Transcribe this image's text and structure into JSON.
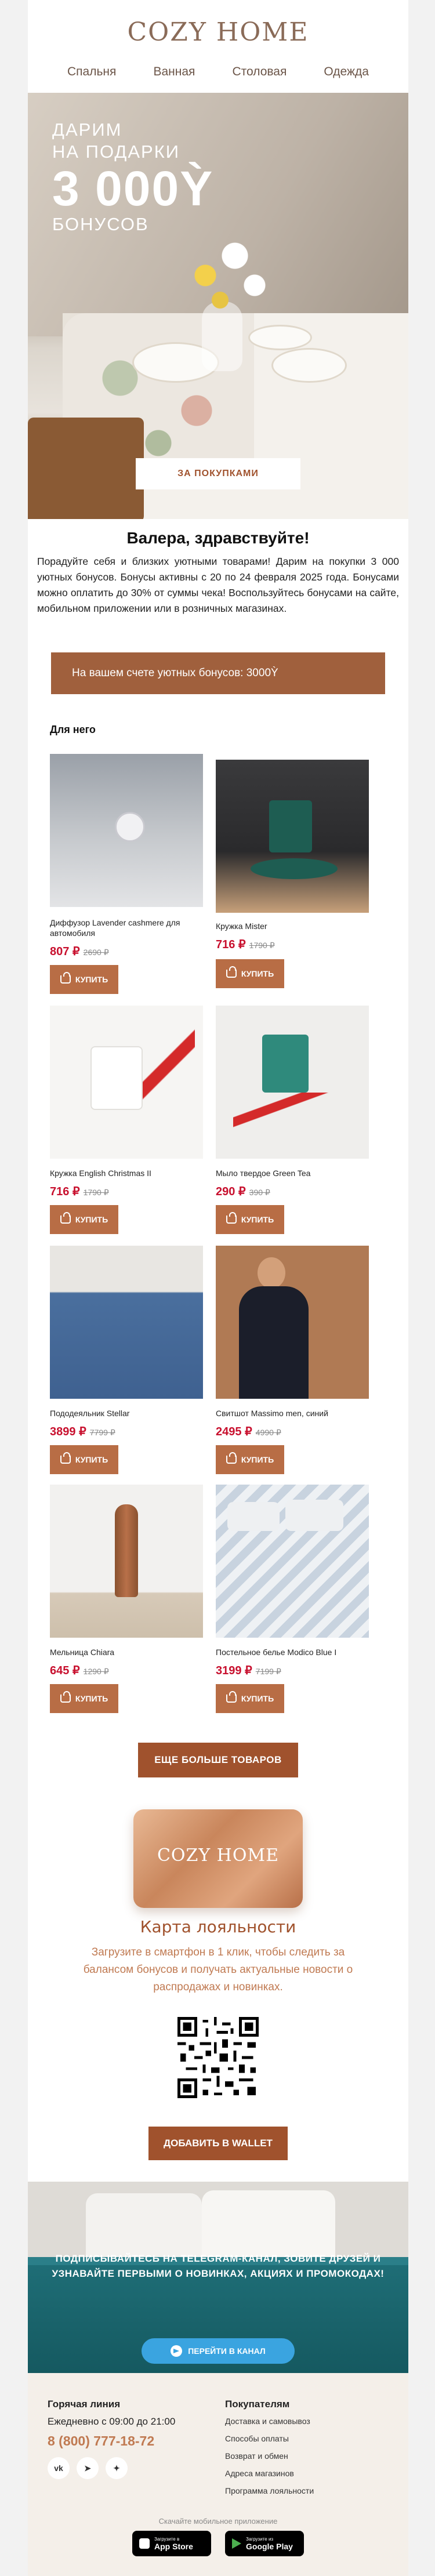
{
  "header": {
    "logo": "COZY HOME",
    "nav": [
      "Спальня",
      "Ванная",
      "Столовая",
      "Одежда"
    ]
  },
  "hero": {
    "line1": "ДАРИМ",
    "line2": "НА ПОДАРКИ",
    "amount": "3 000Ỳ",
    "line3": "БОНУСОВ",
    "cta": "ЗА ПОКУПКАМИ"
  },
  "greeting": {
    "title": "Валера, здравствуйте!",
    "text": "Порадуйте себя и близких уютными товарами! Дарим на покупки 3 000 уютных бонусов. Бонусы активны с 20 по 24 февраля 2025 года. Бонусами можно оплатить до 30% от суммы чека! Воспользуйтесь бонусами на сайте, мобильном приложении или в розничных магазинах.",
    "balance": "На вашем счете уютных бонусов: 3000Ỳ"
  },
  "section_title": "Для него",
  "buy_label": "КУПИТЬ",
  "products": [
    {
      "name": "Диффузор Lavender cashmere для автомобиля",
      "price": "807 ₽",
      "old": "2690 ₽"
    },
    {
      "name": "Кружка Mister",
      "price": "716 ₽",
      "old": "1790 ₽"
    },
    {
      "name": "Кружка English Christmas II",
      "price": "716 ₽",
      "old": "1790 ₽"
    },
    {
      "name": "Мыло твердое Green Tea",
      "price": "290 ₽",
      "old": "390 ₽"
    },
    {
      "name": "Пододеяльник Stellar",
      "price": "3899 ₽",
      "old": "7799 ₽"
    },
    {
      "name": "Свитшот Massimo men, синий",
      "price": "2495 ₽",
      "old": "4990 ₽"
    },
    {
      "name": "Мельница Chiara",
      "price": "645 ₽",
      "old": "1290 ₽"
    },
    {
      "name": "Постельное белье Modico Blue I",
      "price": "3199 ₽",
      "old": "7199 ₽"
    }
  ],
  "more_button": "ЕЩЕ БОЛЬШЕ ТОВАРОВ",
  "loyalty": {
    "card_logo": "COZY HOME",
    "title": "Карта лояльности",
    "text": "Загрузите в смартфон в 1 клик, чтобы следить за балансом бонусов и получать актуальные новости о распродажах и новинках.",
    "wallet_button": "ДОБАВИТЬ В WALLET"
  },
  "telegram": {
    "text": "ПОДПИСЫВАЙТЕСЬ НА TELEGRAM-КАНАЛ, ЗОВИТЕ ДРУЗЕЙ И УЗНАВАЙТЕ ПЕРВЫМИ О НОВИНКАХ, АКЦИЯХ И ПРОМОКОДАХ!",
    "button": "ПЕРЕЙТИ В КАНАЛ"
  },
  "footer": {
    "hotline_title": "Горячая линия",
    "hours": "Ежедневно с 09:00 до 21:00",
    "phone": "8 (800) 777-18-72",
    "social": [
      "vk-icon",
      "telegram-icon",
      "star-icon"
    ],
    "buyers_title": "Покупателям",
    "links": [
      "Доставка и самовывоз",
      "Способы оплаты",
      "Возврат и обмен",
      "Адреса магазинов",
      "Программа лояльности"
    ],
    "apps_label": "Скачайте мобильное приложение",
    "appstore_small": "Загрузите в",
    "appstore": "App Store",
    "gplay_small": "Загрузите из",
    "gplay": "Google Play"
  },
  "colors": {
    "accent": "#a0522d",
    "price_red": "#c8102e",
    "logo": "#8a6b58",
    "telegram": "#3aa4e0"
  }
}
